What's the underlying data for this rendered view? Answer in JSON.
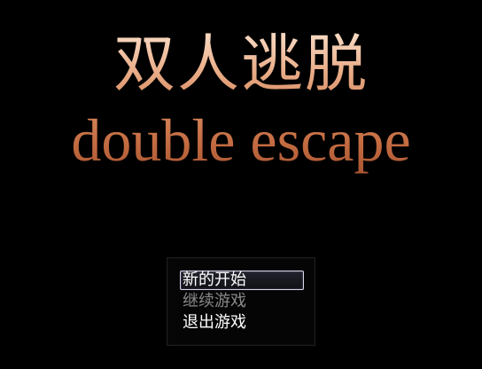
{
  "title": {
    "chinese": "双人逃脱",
    "english": "double escape"
  },
  "menu": {
    "selected_index": 0,
    "items": [
      {
        "label": "新的开始",
        "enabled": true
      },
      {
        "label": "继续游戏",
        "enabled": false
      },
      {
        "label": "退出游戏",
        "enabled": true
      }
    ]
  },
  "colors": {
    "background": "#000000",
    "title_chinese": "#f3c3a3",
    "title_english": "#c8744a",
    "menu_text": "#ffffff",
    "menu_text_disabled": "#8a8a8a",
    "cursor_border": "#d8d8e8"
  }
}
